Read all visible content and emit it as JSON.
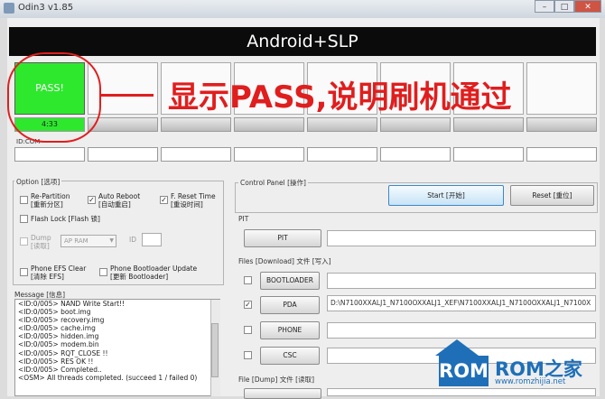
{
  "window": {
    "title": "Odin3 v1.85",
    "minimize": "–",
    "maximize": "□",
    "close": "✕"
  },
  "banner": {
    "text": "Android+SLP"
  },
  "slots": {
    "pass_label": "PASS!",
    "pass_time": "4:33"
  },
  "idcom_label": "ID:COM",
  "annotation": {
    "text": "显示PASS,说明刷机通过"
  },
  "option": {
    "title": "Option [选项]",
    "repartition": {
      "label1": "Re-Partition",
      "label2": "[重新分区]",
      "checked": false
    },
    "auto_reboot": {
      "label1": "Auto Reboot",
      "label2": "[自动重启]",
      "checked": true
    },
    "f_reset_time": {
      "label1": "F. Reset Time",
      "label2": "[重设时间]",
      "checked": true
    },
    "flash_lock": {
      "label": "Flash Lock [Flash 锁]",
      "checked": false
    },
    "dump": {
      "label1": "Dump",
      "label2": "[读取]",
      "checked": false
    },
    "dump_select": "AP RAM",
    "id_label": "ID",
    "phone_efs": {
      "label1": "Phone EFS Clear",
      "label2": "[清除 EFS]",
      "checked": false
    },
    "phone_bootloader": {
      "label1": "Phone Bootloader Update",
      "label2": "[更新 Bootloader]",
      "checked": false
    }
  },
  "message": {
    "title": "Message [信息]",
    "lines": [
      "<ID:0/005> NAND Write Start!!",
      "<ID:0/005> boot.img",
      "<ID:0/005> recovery.img",
      "<ID:0/005> cache.img",
      "<ID:0/005> hidden.img",
      "<ID:0/005> modem.bin",
      "<ID:0/005> RQT_CLOSE !!",
      "<ID:0/005> RES OK !!",
      "<ID:0/005> Completed..",
      "<OSM> All threads completed. (succeed 1 / failed 0)"
    ]
  },
  "control_panel": {
    "title": "Control Panel [操作]",
    "start_label": "Start [开始]",
    "reset_label": "Reset [重位]"
  },
  "pit": {
    "title": "PIT",
    "button": "PIT"
  },
  "files": {
    "title": "Files [Download] 文件 [写入]",
    "rows": [
      {
        "label": "BOOTLOADER",
        "checked": false,
        "path": ""
      },
      {
        "label": "PDA",
        "checked": true,
        "path": "D:\\N7100XXALJ1_N7100OXXALJ1_XEF\\N7100XXALJ1_N7100OXXALJ1_N7100X"
      },
      {
        "label": "PHONE",
        "checked": false,
        "path": ""
      },
      {
        "label": "CSC",
        "checked": false,
        "path": ""
      }
    ]
  },
  "file_dump": {
    "title": "File [Dump] 文件 [读取]"
  },
  "watermark": {
    "logo": "ROM",
    "name": "ROM之家",
    "url": "www.romzhijia.net"
  }
}
